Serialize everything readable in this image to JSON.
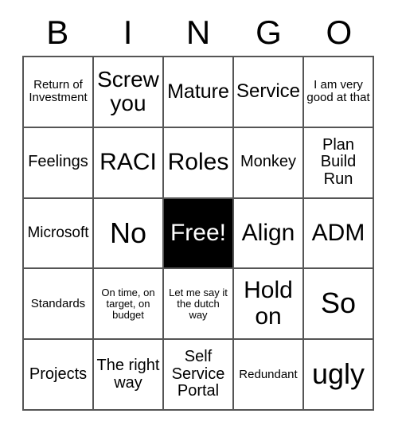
{
  "card": {
    "header_letters": [
      "B",
      "I",
      "N",
      "G",
      "O"
    ],
    "columns": 5,
    "rows": 5,
    "free_space_label": "Free!",
    "free_space_position": {
      "row": 3,
      "column": 3
    },
    "colors": {
      "background": "#ffffff",
      "text": "#000000",
      "grid_line": "#555555",
      "free_space_background": "#000000",
      "free_space_text": "#ffffff"
    },
    "cells": [
      {
        "text": "Return of Investment",
        "size": "xs",
        "free": false
      },
      {
        "text": "Screw you",
        "size": "lg",
        "free": false
      },
      {
        "text": "Mature",
        "size": "md",
        "free": false
      },
      {
        "text": "Service",
        "size": "md",
        "free": false
      },
      {
        "text": "I am very good at that",
        "size": "xs",
        "free": false
      },
      {
        "text": "Feelings",
        "size": "sm",
        "free": false
      },
      {
        "text": "RACI",
        "size": "lg",
        "free": false
      },
      {
        "text": "Roles",
        "size": "lg",
        "free": false
      },
      {
        "text": "Monkey",
        "size": "sm",
        "free": false
      },
      {
        "text": "Plan Build Run",
        "size": "sm",
        "free": false
      },
      {
        "text": "Microsoft",
        "size": "sm",
        "free": false
      },
      {
        "text": "No",
        "size": "xl",
        "free": false
      },
      {
        "text": "Free!",
        "size": "lg",
        "free": true
      },
      {
        "text": "Align",
        "size": "lg",
        "free": false
      },
      {
        "text": "ADM",
        "size": "lg",
        "free": false
      },
      {
        "text": "Standards",
        "size": "xs",
        "free": false
      },
      {
        "text": "On time, on target, on budget",
        "size": "xxs",
        "free": false
      },
      {
        "text": "Let me say it the dutch way",
        "size": "xxs",
        "free": false
      },
      {
        "text": "Hold on",
        "size": "lg",
        "free": false
      },
      {
        "text": "So",
        "size": "xl",
        "free": false
      },
      {
        "text": "Projects",
        "size": "sm",
        "free": false
      },
      {
        "text": "The right way",
        "size": "sm",
        "free": false
      },
      {
        "text": "Self Service Portal",
        "size": "sm",
        "free": false
      },
      {
        "text": "Redundant",
        "size": "xs",
        "free": false
      },
      {
        "text": "ugly",
        "size": "xl",
        "free": false
      }
    ]
  }
}
